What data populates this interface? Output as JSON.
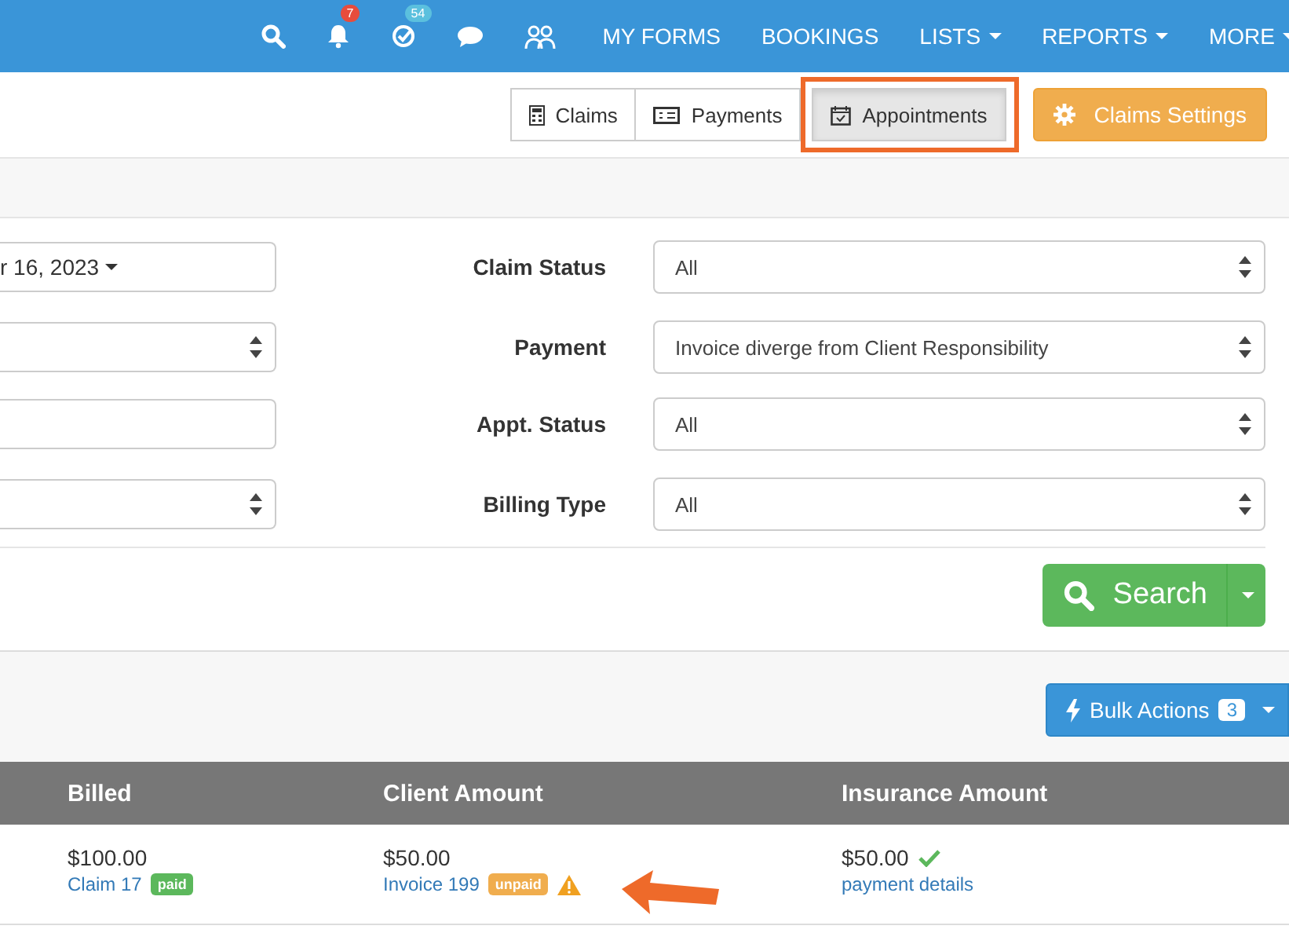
{
  "top_nav": {
    "icons": [
      {
        "kind": "search"
      },
      {
        "kind": "bell",
        "badge": "7"
      },
      {
        "kind": "check",
        "badge": "54"
      },
      {
        "kind": "chat"
      },
      {
        "kind": "people"
      }
    ],
    "menu": [
      {
        "label": "MY FORMS",
        "dropdown": false
      },
      {
        "label": "BOOKINGS",
        "dropdown": false
      },
      {
        "label": "LISTS",
        "dropdown": true
      },
      {
        "label": "REPORTS",
        "dropdown": true
      },
      {
        "label": "MORE",
        "dropdown": true
      }
    ]
  },
  "view_tabs": [
    {
      "label": "Claims",
      "selected": false
    },
    {
      "label": "Payments",
      "selected": false
    },
    {
      "label": "Appointments",
      "selected": true,
      "highlighted": true
    }
  ],
  "settings_button": {
    "label": "Claims Settings"
  },
  "filters": {
    "left": [
      {
        "kind": "date",
        "value": "r 16, 2023"
      },
      {
        "kind": "select"
      },
      {
        "kind": "text"
      },
      {
        "kind": "select"
      }
    ],
    "right": [
      {
        "label": "Claim Status",
        "value": "All"
      },
      {
        "label": "Payment",
        "value": "Invoice diverge from Client Responsibility"
      },
      {
        "label": "Appt. Status",
        "value": "All"
      },
      {
        "label": "Billing Type",
        "value": "All"
      }
    ]
  },
  "search_button": {
    "label": "Search"
  },
  "bulk_actions": {
    "label": "Bulk Actions",
    "count": "3"
  },
  "table": {
    "columns": [
      "Billed",
      "Client Amount",
      "Insurance Amount"
    ],
    "rows": [
      {
        "billed": "$100.00",
        "billed_link": "Claim 17",
        "billed_badge": {
          "label": "paid",
          "kind": "paid"
        },
        "client": "$50.00",
        "client_link": "Invoice 199",
        "client_badge": {
          "label": "unpaid",
          "kind": "unpaid"
        },
        "client_warning": true,
        "insurance": "$50.00",
        "insurance_ok": true,
        "insurance_link": "payment details"
      }
    ]
  },
  "annotation_arrow": true
}
